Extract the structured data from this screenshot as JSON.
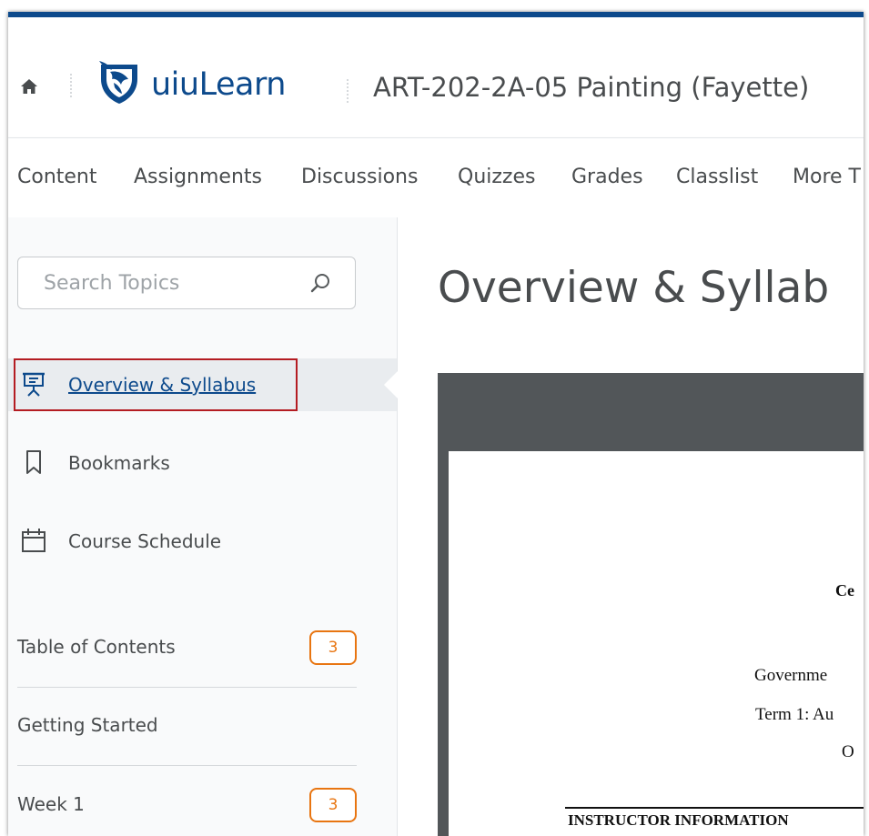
{
  "header": {
    "logo_text": "uiuLearn",
    "course_title": "ART-202-2A-05 Painting (Fayette)"
  },
  "colors": {
    "brand_blue": "#0d4a8c",
    "badge_orange": "#e87511",
    "focus_red": "#b41c22"
  },
  "nav": {
    "items": [
      "Content",
      "Assignments",
      "Discussions",
      "Quizzes",
      "Grades",
      "Classlist",
      "More T"
    ]
  },
  "sidebar": {
    "search_placeholder": "Search Topics",
    "links": [
      {
        "label": "Overview & Syllabus",
        "icon": "presentation-icon"
      },
      {
        "label": "Bookmarks",
        "icon": "bookmark-icon"
      },
      {
        "label": "Course Schedule",
        "icon": "calendar-icon"
      }
    ],
    "modules": [
      {
        "label": "Table of Contents",
        "count": "3"
      },
      {
        "label": "Getting Started",
        "count": ""
      },
      {
        "label": "Week 1",
        "count": "3"
      }
    ]
  },
  "main": {
    "title": "Overview & Syllab",
    "doc": {
      "line1": "Ce",
      "line2": "Governme",
      "line3": "Term 1: Au",
      "line4": "O",
      "section_heading": "INSTRUCTOR INFORMATION"
    }
  }
}
